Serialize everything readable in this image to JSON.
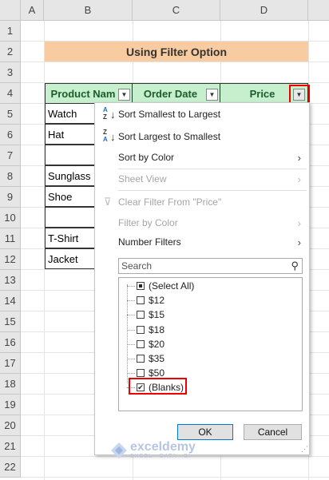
{
  "columns": [
    "A",
    "B",
    "C",
    "D"
  ],
  "rows": [
    "1",
    "2",
    "3",
    "4",
    "5",
    "6",
    "7",
    "8",
    "9",
    "10",
    "11",
    "12",
    "13",
    "14",
    "15",
    "16",
    "17",
    "18",
    "19",
    "20",
    "21",
    "22"
  ],
  "title": "Using Filter Option",
  "headers": {
    "product": "Product Nam",
    "order_date": "Order Date",
    "price": "Price"
  },
  "products": [
    "Watch",
    "Hat",
    "",
    "Sunglass",
    "Shoe",
    "",
    "T-Shirt",
    "Jacket"
  ],
  "menu": {
    "sort_asc": "Sort Smallest to Largest",
    "sort_desc": "Sort Largest to Smallest",
    "sort_color": "Sort by Color",
    "sheet_view": "Sheet View",
    "clear_filter": "Clear Filter From \"Price\"",
    "filter_color": "Filter by Color",
    "number_filters": "Number Filters",
    "search_placeholder": "Search",
    "items": [
      {
        "label": "(Select All)",
        "state": "partial"
      },
      {
        "label": "$12",
        "state": "unchecked"
      },
      {
        "label": "$15",
        "state": "unchecked"
      },
      {
        "label": "$18",
        "state": "unchecked"
      },
      {
        "label": "$20",
        "state": "unchecked"
      },
      {
        "label": "$35",
        "state": "unchecked"
      },
      {
        "label": "$50",
        "state": "unchecked"
      },
      {
        "label": "(Blanks)",
        "state": "checked"
      }
    ],
    "ok": "OK",
    "cancel": "Cancel"
  },
  "sort_icon_asc": [
    "A",
    "Z"
  ],
  "sort_icon_desc": [
    "Z",
    "A"
  ],
  "watermark": {
    "brand": "exceldemy",
    "tagline": "EXCEL · DATA · BI"
  },
  "colors": {
    "header_fill": "#c6efce",
    "title_fill": "#f8cba0",
    "highlight": "#e00000"
  }
}
